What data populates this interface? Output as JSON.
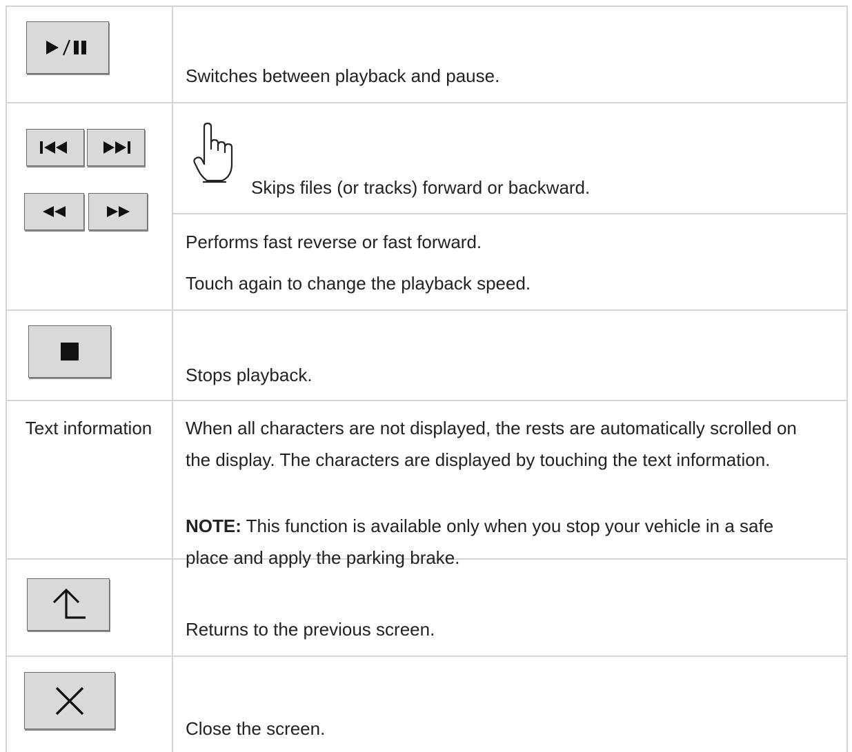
{
  "rows": [
    {
      "button_icons": [
        "play-pause-icon"
      ],
      "description": "Switches between playback and pause."
    },
    {
      "button_icons": [
        "skip-backward-icon",
        "skip-forward-icon",
        "fast-reverse-icon",
        "fast-forward-icon"
      ],
      "touch_icon": "hand-touch-icon",
      "description": "Skips files (or tracks) forward or backward.",
      "description_2": "Performs fast reverse or fast forward.",
      "description_3": "Touch again to change the playback speed."
    },
    {
      "button_icons": [
        "stop-icon"
      ],
      "description": "Stops playback."
    },
    {
      "label": "Text information",
      "description_line_1": "When all characters are not displayed, the rests are automatically scrolled on",
      "description_line_2": "the display. The characters are displayed by touching the text information.",
      "note_label": "NOTE:",
      "note_line_1": " This function is available only when you stop your vehicle in a safe",
      "note_line_2": "place and apply the parking brake."
    },
    {
      "button_icons": [
        "return-arrow-icon"
      ],
      "description": "Returns to the previous screen."
    },
    {
      "button_icons": [
        "close-icon"
      ],
      "description": "Close the screen."
    }
  ],
  "colors": {
    "grid": "#d4d4d4",
    "button_face": "#d9d9d9",
    "icon": "#111111",
    "text": "#222222"
  }
}
